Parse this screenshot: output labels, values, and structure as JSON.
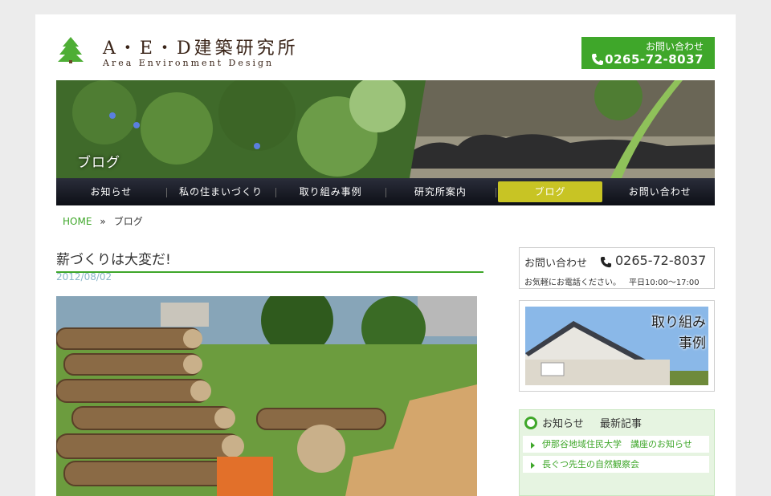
{
  "header": {
    "logo_title": "A・E・D建築研究所",
    "logo_subtitle": "Area Environment Design",
    "contact_label": "お問い合わせ",
    "contact_tel": "0265-72-8037"
  },
  "banner": {
    "title": "ブログ"
  },
  "nav": {
    "items": [
      {
        "label": "お知らせ"
      },
      {
        "label": "私の住まいづくり"
      },
      {
        "label": "取り組み事例"
      },
      {
        "label": "研究所案内"
      },
      {
        "label": "ブログ"
      },
      {
        "label": "お問い合わせ"
      }
    ],
    "active_index": 4
  },
  "breadcrumb": {
    "home": "HOME",
    "separator": "»",
    "current": "ブログ"
  },
  "post": {
    "title": "薪づくりは大変だ!",
    "date": "2012/08/02"
  },
  "sidebar": {
    "contact": {
      "label": "お問い合わせ",
      "tel": "0265-72-8037",
      "note": "お気軽にお電話ください。",
      "hours": "平日10:00～17:00"
    },
    "works": {
      "line1": "取り組み",
      "line2": "事例"
    },
    "news": {
      "title": "お知らせ",
      "subtitle": "最新記事",
      "items": [
        {
          "label": "伊那谷地域住民大学　講座のお知らせ"
        },
        {
          "label": "長ぐつ先生の自然観察会"
        }
      ]
    }
  },
  "colors": {
    "accent": "#3fa72a",
    "nav_active": "#c8c424",
    "nav_bg": "#1a1c26"
  }
}
